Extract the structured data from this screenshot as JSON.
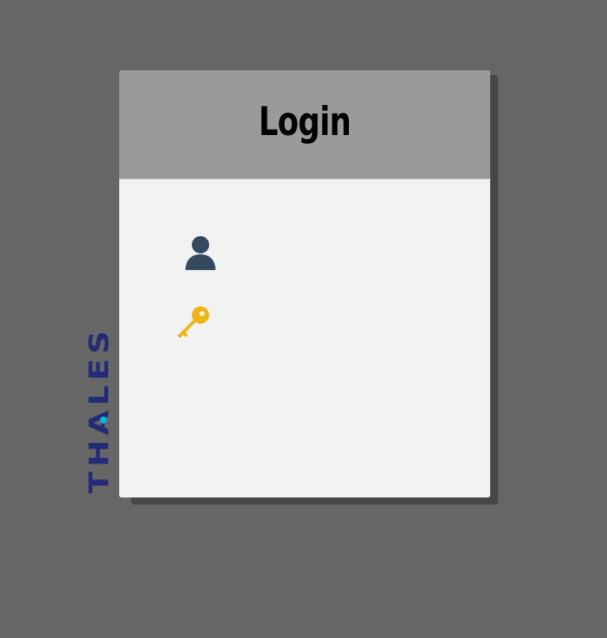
{
  "page": {
    "background_color": "#666666"
  },
  "login_card": {
    "title": "Login",
    "header_color": "#9a9a9a",
    "body_color": "#f2f2f2",
    "username_field": {
      "icon": "user-icon",
      "icon_color": "#34495e"
    },
    "password_field": {
      "icon": "key-icon",
      "icon_color": "#f1b418"
    }
  },
  "brand": {
    "name": "THALES",
    "color": "#242a75",
    "accent_color": "#00bbdd"
  }
}
